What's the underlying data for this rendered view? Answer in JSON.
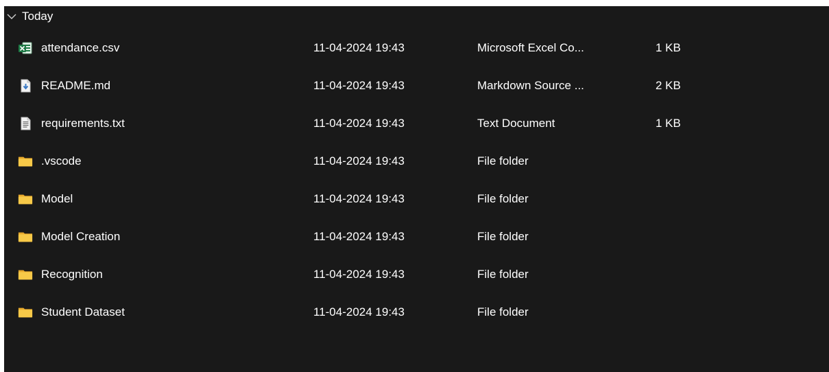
{
  "group": {
    "label": "Today",
    "icon": "chevron-down-icon"
  },
  "files": [
    {
      "name": "attendance.csv",
      "date": "11-04-2024 19:43",
      "type": "Microsoft Excel Co...",
      "size": "1 KB",
      "icon": "excel-file-icon"
    },
    {
      "name": "README.md",
      "date": "11-04-2024 19:43",
      "type": "Markdown Source ...",
      "size": "2 KB",
      "icon": "markdown-file-icon"
    },
    {
      "name": "requirements.txt",
      "date": "11-04-2024 19:43",
      "type": "Text Document",
      "size": "1 KB",
      "icon": "text-file-icon"
    },
    {
      "name": ".vscode",
      "date": "11-04-2024 19:43",
      "type": "File folder",
      "size": "",
      "icon": "folder-icon"
    },
    {
      "name": "Model",
      "date": "11-04-2024 19:43",
      "type": "File folder",
      "size": "",
      "icon": "folder-icon"
    },
    {
      "name": "Model Creation",
      "date": "11-04-2024 19:43",
      "type": "File folder",
      "size": "",
      "icon": "folder-icon"
    },
    {
      "name": "Recognition",
      "date": "11-04-2024 19:43",
      "type": "File folder",
      "size": "",
      "icon": "folder-icon"
    },
    {
      "name": "Student Dataset",
      "date": "11-04-2024 19:43",
      "type": "File folder",
      "size": "",
      "icon": "folder-icon"
    }
  ],
  "colors": {
    "background": "#191919",
    "text": "#ffffff",
    "folder": "#f7c948",
    "excel": "#1d7a45"
  }
}
